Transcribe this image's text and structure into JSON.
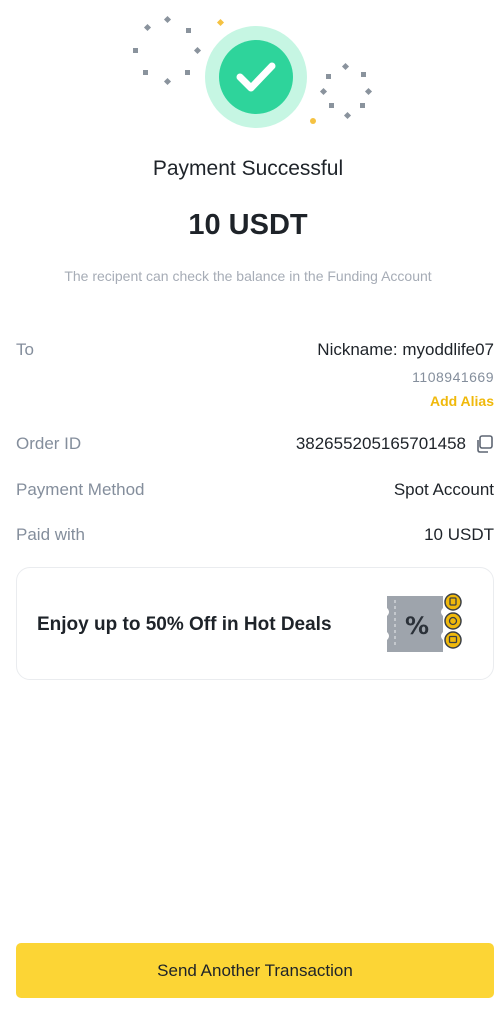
{
  "header": {
    "status_title": "Payment Successful",
    "amount": "10 USDT",
    "note": "The recipent can check the balance in the Funding Account"
  },
  "details": {
    "to_label": "To",
    "to_nickname": "Nickname: myoddlife07",
    "to_uid": "1108941669",
    "add_alias_label": "Add Alias",
    "order_id_label": "Order ID",
    "order_id": "382655205165701458",
    "payment_method_label": "Payment Method",
    "payment_method": "Spot Account",
    "paid_with_label": "Paid with",
    "paid_with": "10 USDT"
  },
  "promo": {
    "text": "Enjoy up to 50% Off in Hot Deals",
    "icon": "discount-ticket-icon"
  },
  "footer": {
    "cta_label": "Send Another Transaction"
  },
  "colors": {
    "accent": "#f0b90b",
    "button": "#fcd535",
    "success": "#2ed49b",
    "success_halo": "#c6f6e3"
  }
}
